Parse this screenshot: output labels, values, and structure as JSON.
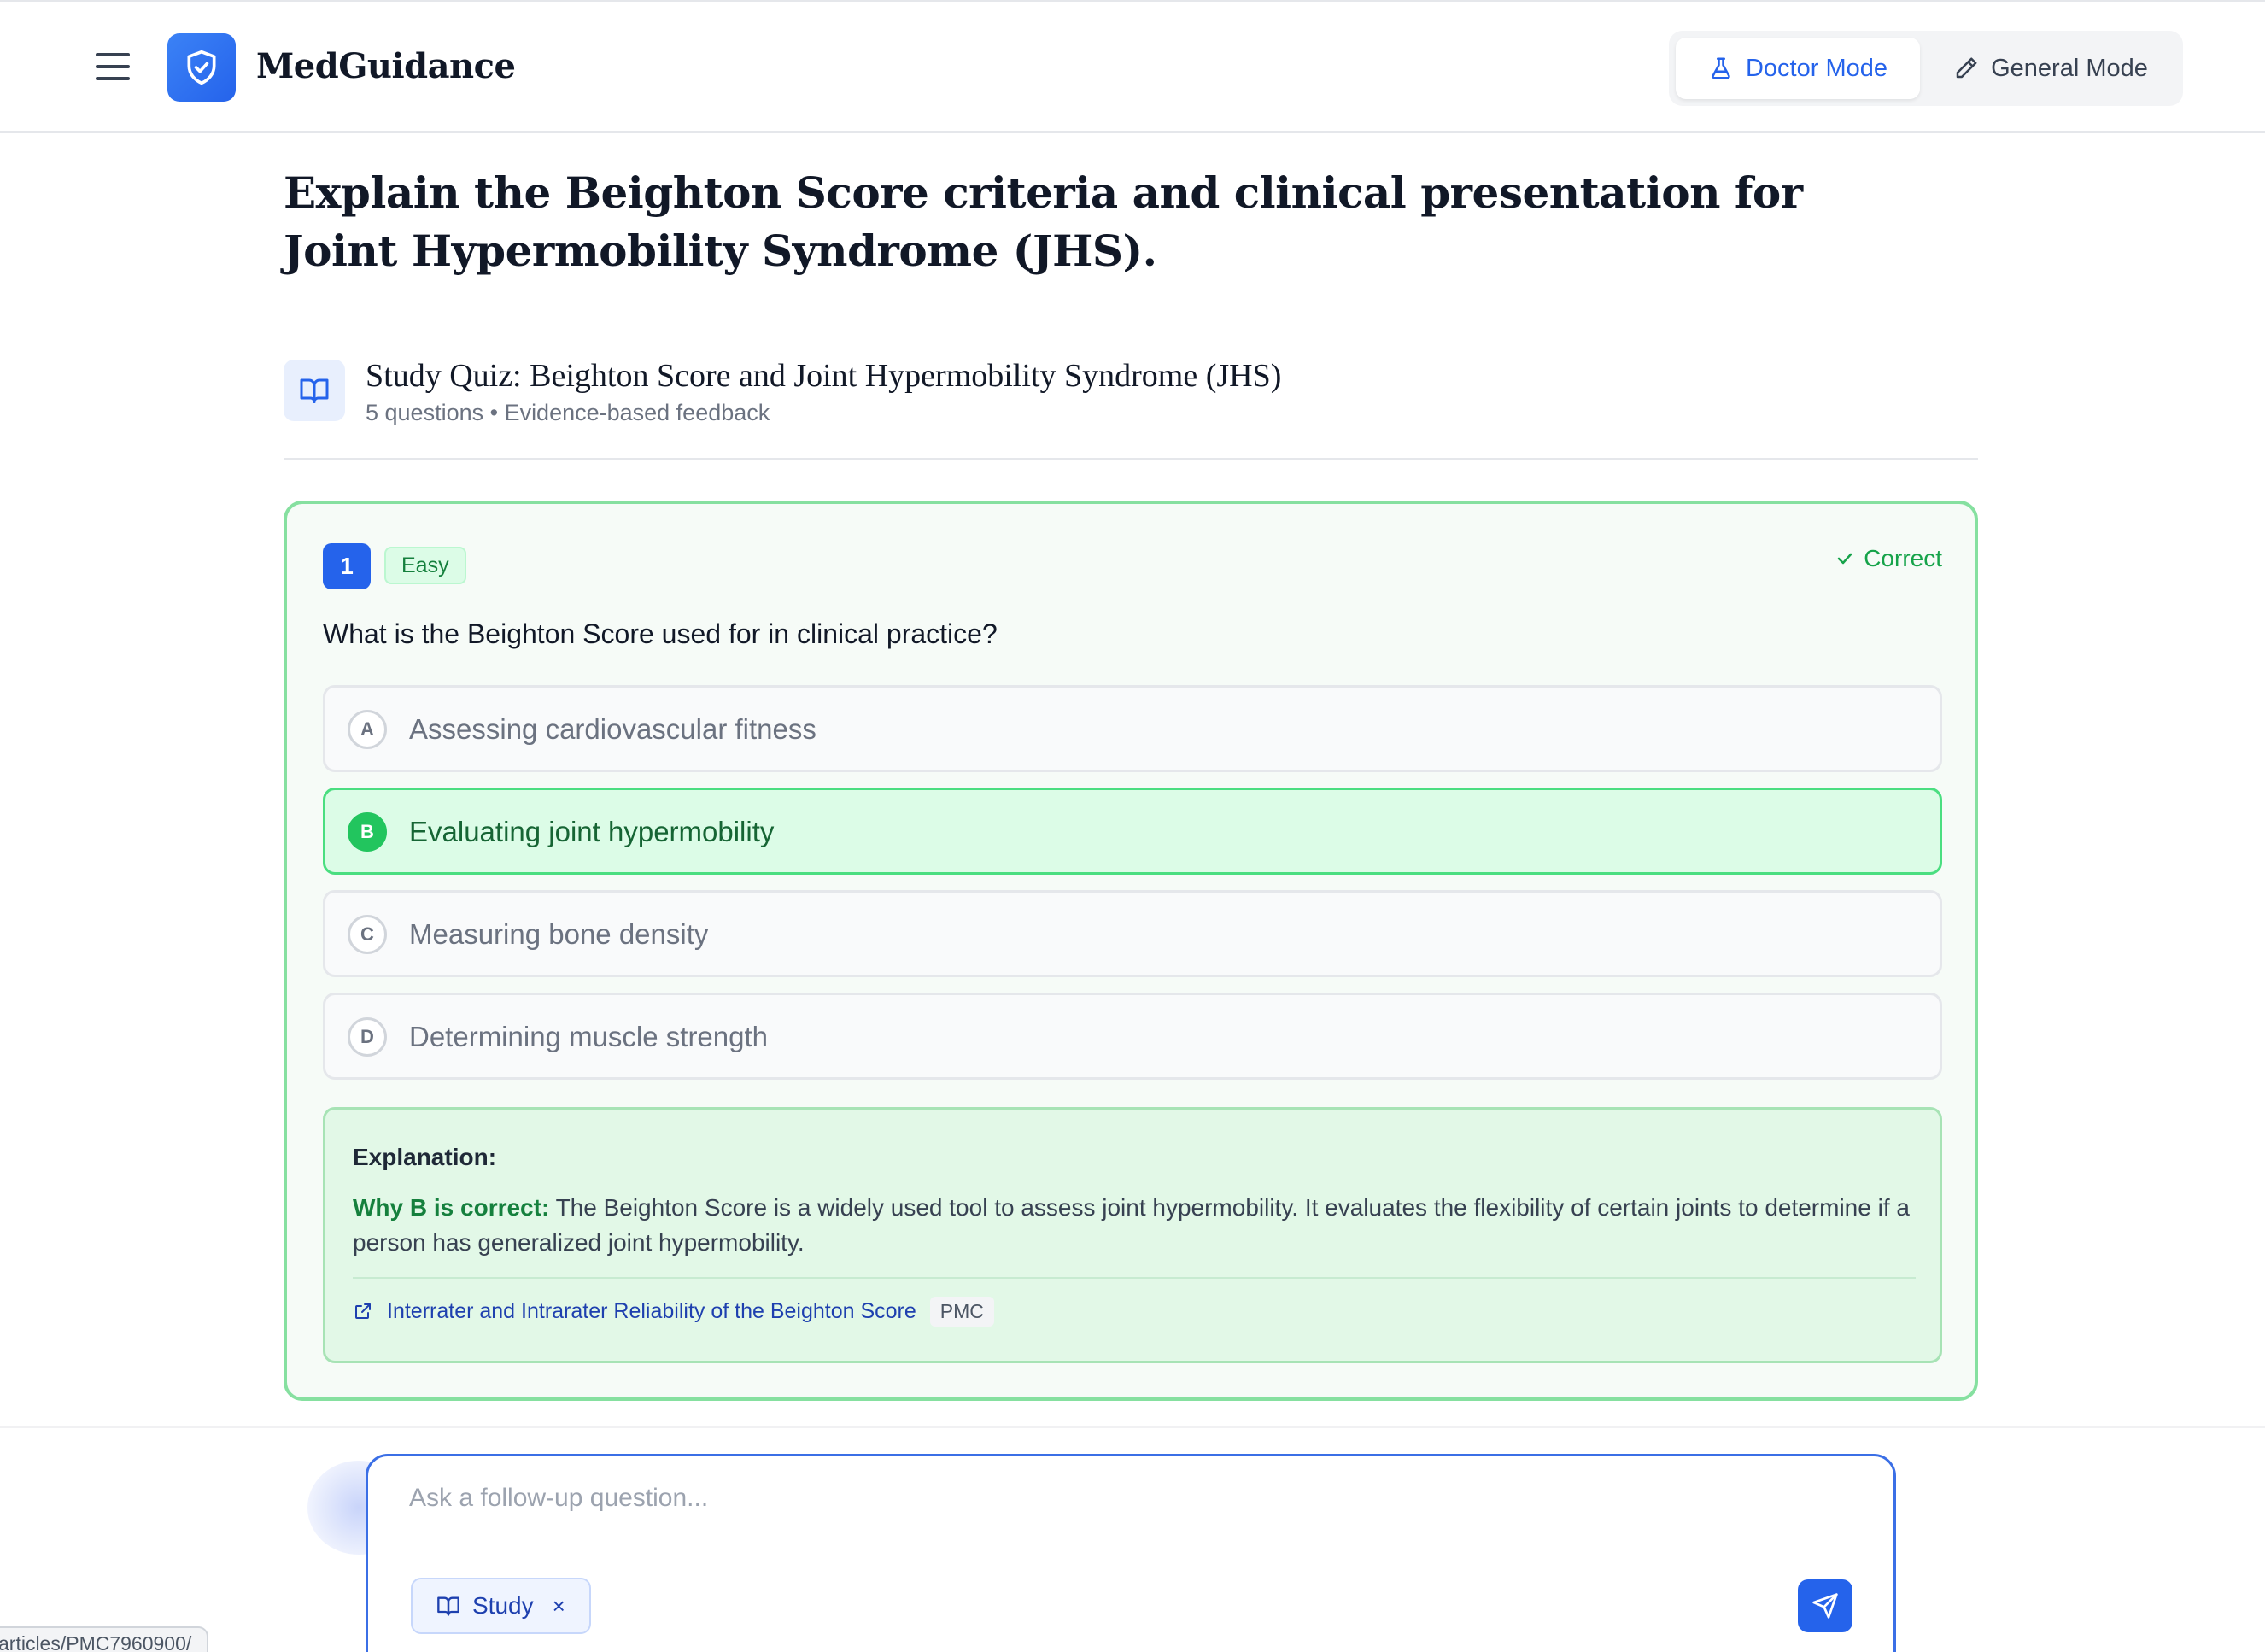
{
  "header": {
    "brand": "MedGuidance",
    "modes": {
      "doctor": "Doctor Mode",
      "general": "General Mode",
      "active": "doctor"
    },
    "colors": {
      "accent": "#2563eb"
    }
  },
  "page_title": "Explain the Beighton Score criteria and clinical presentation for Joint Hypermobility Syndrome (JHS).",
  "quiz": {
    "title": "Study Quiz: Beighton Score and Joint Hypermobility Syndrome (JHS)",
    "subtitle": "5 questions • Evidence-based feedback"
  },
  "question": {
    "number": "1",
    "difficulty": "Easy",
    "status": "Correct",
    "text": "What is the Beighton Score used for in clinical practice?",
    "options": [
      {
        "letter": "A",
        "text": "Assessing cardiovascular fitness"
      },
      {
        "letter": "B",
        "text": "Evaluating joint hypermobility",
        "correct": true
      },
      {
        "letter": "C",
        "text": "Measuring bone density"
      },
      {
        "letter": "D",
        "text": "Determining muscle strength"
      }
    ],
    "explanation": {
      "label": "Explanation:",
      "why_label": "Why B is correct:",
      "body": "The Beighton Score is a widely used tool to assess joint hypermobility. It evaluates the flexibility of certain joints to determine if a person has generalized joint hypermobility.",
      "source_title": "Interrater and Intrarater Reliability of the Beighton Score",
      "source_tag": "PMC"
    }
  },
  "composer": {
    "placeholder": "Ask a follow-up question...",
    "chip_label": "Study",
    "chip_remove": "×"
  },
  "status_bar_url": "articles/PMC7960900/"
}
